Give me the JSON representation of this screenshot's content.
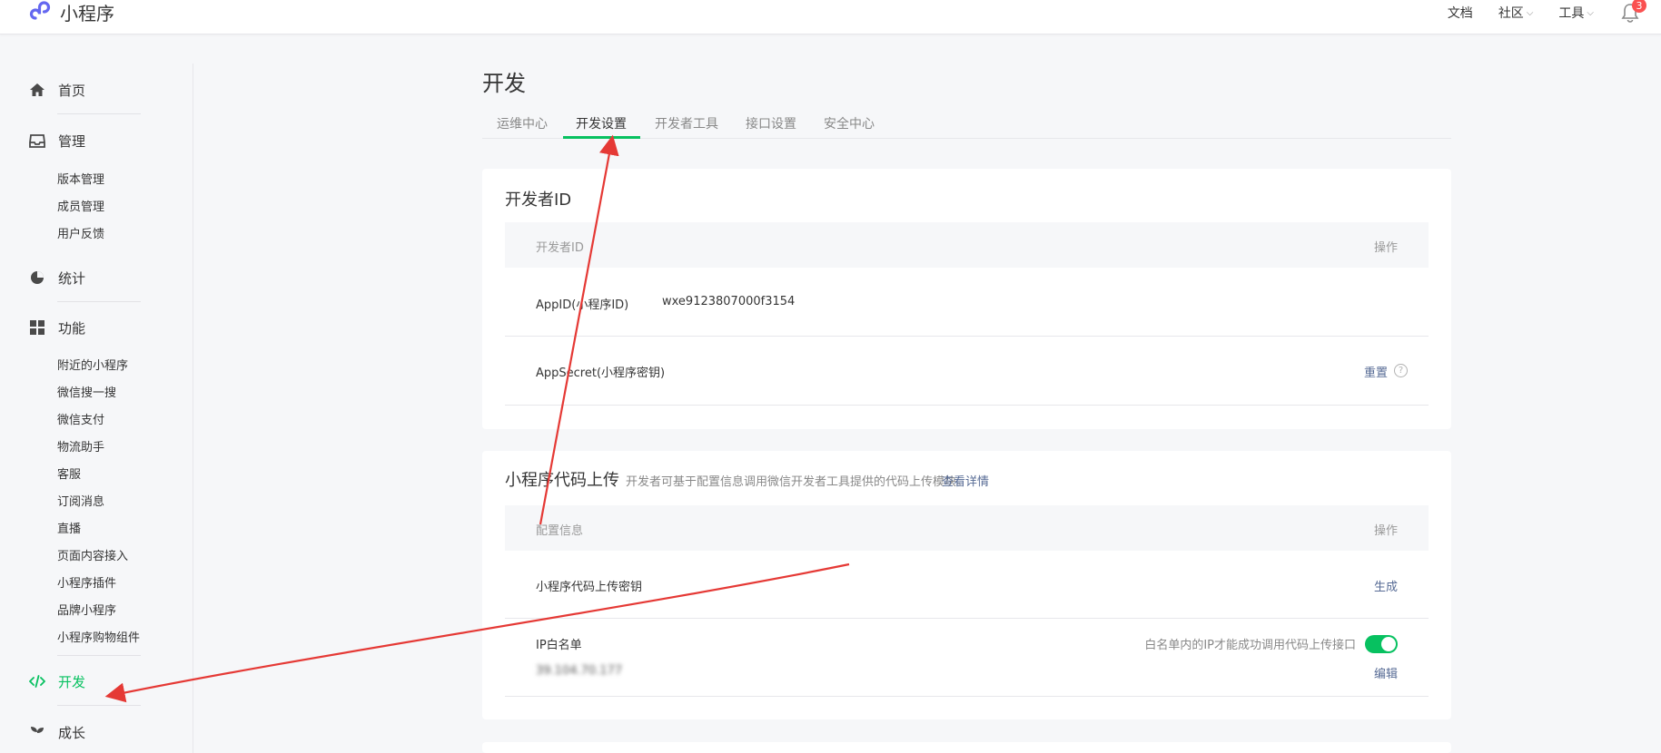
{
  "app": {
    "name": "小程序"
  },
  "topnav": {
    "docs": "文档",
    "community": "社区",
    "tools": "工具",
    "notifications": "3"
  },
  "sidebar": {
    "home": "首页",
    "manage": "管理",
    "manage_items": [
      "版本管理",
      "成员管理",
      "用户反馈"
    ],
    "stats": "统计",
    "features": "功能",
    "feature_items": [
      "附近的小程序",
      "微信搜一搜",
      "微信支付",
      "物流助手",
      "客服",
      "订阅消息",
      "直播",
      "页面内容接入",
      "小程序插件",
      "品牌小程序",
      "小程序购物组件"
    ],
    "dev": "开发",
    "growth": "成长"
  },
  "main": {
    "title": "开发",
    "tabs": [
      "运维中心",
      "开发设置",
      "开发者工具",
      "接口设置",
      "安全中心"
    ],
    "active_tab": 1
  },
  "developer_id": {
    "title": "开发者ID",
    "col_id": "开发者ID",
    "col_action": "操作",
    "appid_label": "AppID(小程序ID)",
    "appid_value": "wxe9123807000f3154",
    "secret_label": "AppSecret(小程序密钥)",
    "reset": "重置",
    "help": "?"
  },
  "upload": {
    "title": "小程序代码上传",
    "desc": "开发者可基于配置信息调用微信开发者工具提供的代码上传模块。",
    "detail_link": "查看详情",
    "col_config": "配置信息",
    "col_action": "操作",
    "key_label": "小程序代码上传密钥",
    "generate": "生成",
    "whitelist_label": "IP白名单",
    "whitelist_hint": "白名单内的IP才能成功调用代码上传接口",
    "whitelist_enabled": true,
    "ip_value": "39.104.70.177",
    "edit": "编辑"
  },
  "colors": {
    "accent": "#07c160",
    "link": "#576b95",
    "arrow": "#e53935",
    "badge": "#fa5151"
  }
}
